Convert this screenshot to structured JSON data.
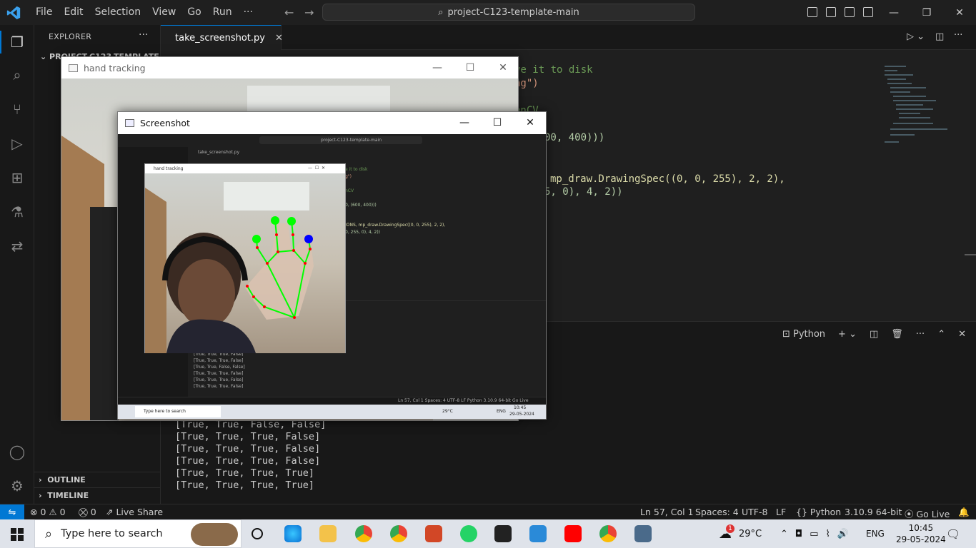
{
  "titlebar": {
    "menu": [
      "File",
      "Edit",
      "Selection",
      "View",
      "Go",
      "Run",
      "···"
    ],
    "search": "project-C123-template-main"
  },
  "sidebar": {
    "title": "EXPLORER",
    "project": "PROJECT-C123-TEMPLATE",
    "outline": "OUTLINE",
    "timeline": "TIMELINE"
  },
  "editor": {
    "tab": "take_screenshot.py",
    "lines": [
      "ve it to disk",
      "ng\")",
      "enCV",
      "00, 400)))",
      "mp_draw.DrawingSpec((0, 0, 255), 2, 2),",
      "5, 0), 4, 2))"
    ]
  },
  "panel": {
    "terminal_label": "Python",
    "output": [
      "[True, True, False, False]",
      "[True, True, True, False]",
      "[True, True, True, False]",
      "[True, True, True, False]",
      "[True, True, True, True]",
      "[True, True, True, True]"
    ]
  },
  "statusbar": {
    "errors": "0",
    "warnings": "0",
    "ports": "0",
    "live_share": "Live Share",
    "position": "Ln 57, Col 1",
    "spaces": "Spaces: 4",
    "encoding": "UTF-8",
    "eol": "LF",
    "language": "Python",
    "interpreter": "3.10.9 64-bit",
    "go_live": "Go Live"
  },
  "taskbar": {
    "search_placeholder": "Type here to search",
    "weather": "29°C",
    "weather_badge": "1",
    "lang": "ENG",
    "time": "10:45",
    "date": "29-05-2024"
  },
  "hand_window": {
    "title": "hand tracking"
  },
  "screenshot_window": {
    "title": "Screenshot",
    "mini": {
      "search": "project-C123-template-main",
      "tab": "take_screenshot.py",
      "hand_title": "hand tracking",
      "code": [
        "e it to disk",
        "g\")",
        "nCV",
        "0, (600, 400)))",
        "IONS, mp_draw.DrawingSpec((0, 0, 255), 2, 2),",
        "0, 255, 0), 4, 2))"
      ],
      "output": [
        "[True, True, True, False]",
        "[True, True, True, False]",
        "[True, True, False, False]",
        "[True, True, True, False]",
        "[True, True, True, False]",
        "[True, True, True, False]"
      ],
      "status": "Ln 57, Col 1   Spaces: 4   UTF-8   LF   Python   3.10.9 64-bit   Go Live",
      "taskbar_search": "Type here to search",
      "weather": "29°C",
      "lang": "ENG",
      "time": "10:45",
      "date": "29-05-2024"
    }
  },
  "colors": {
    "accent": "#0078d4",
    "editor_bg": "#1f1f1f",
    "landmark_line": "#00ff00",
    "landmark_point": "#ff0000",
    "fingertip_blue": "#0000ff"
  }
}
